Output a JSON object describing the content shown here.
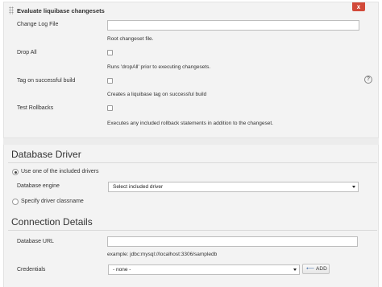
{
  "step": {
    "title": "Evaluate liquibase changesets",
    "close_label": "x"
  },
  "fields": {
    "change_log_file": {
      "label": "Change Log File",
      "value": "",
      "description": "Root changeset file."
    },
    "drop_all": {
      "label": "Drop All",
      "checked": false,
      "description": "Runs 'dropAll' prior to executing changesets."
    },
    "tag_on_build": {
      "label": "Tag on successful build",
      "checked": false,
      "description": "Creates a liquibase tag on successful build"
    },
    "test_rollbacks": {
      "label": "Test Rollbacks",
      "checked": false,
      "description": "Executes any included rollback statements in addition to the changeset."
    }
  },
  "help_label": "?",
  "database_driver": {
    "title": "Database Driver",
    "included_drivers_label": "Use one of the included drivers",
    "included_drivers_selected": true,
    "engine_label": "Database engine",
    "engine_value": "Select included driver",
    "specify_classname_label": "Specify driver classname",
    "specify_classname_selected": false
  },
  "connection": {
    "title": "Connection Details",
    "url_label": "Database URL",
    "url_value": "",
    "url_example": "example: jdbc:mysql://localhost:3306/sampledb",
    "credentials_label": "Credentials",
    "credentials_value": "- none -",
    "add_label": "ADD",
    "add_icon": "key-icon"
  }
}
